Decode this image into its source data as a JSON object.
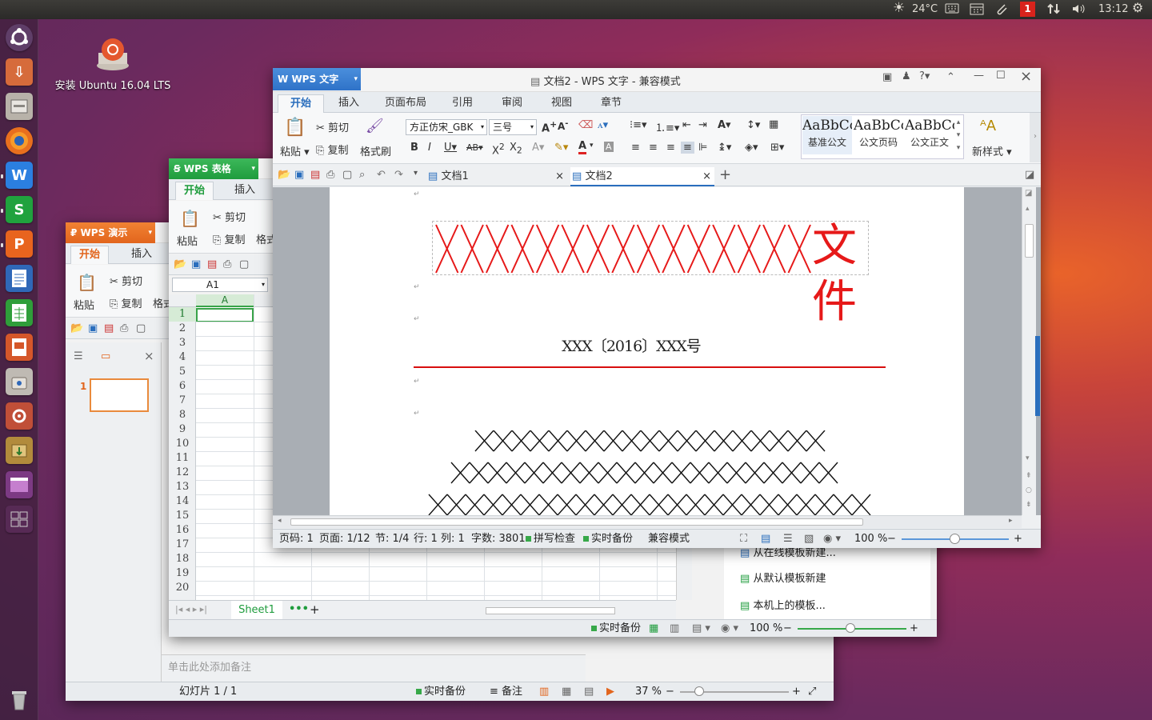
{
  "topbar": {
    "temperature": "24°C",
    "notification_count": "1",
    "time": "13:12"
  },
  "desktop": {
    "install_label": "安装 Ubuntu 16.04 LTS"
  },
  "writer": {
    "app_badge": "WPS 文字",
    "window_title": "文档2 - WPS 文字 - 兼容模式",
    "tabs": [
      "开始",
      "插入",
      "页面布局",
      "引用",
      "审阅",
      "视图",
      "章节"
    ],
    "ribbon": {
      "paste": "粘贴",
      "cut": "剪切",
      "copy": "复制",
      "format_painter": "格式刷",
      "font": "方正仿宋_GBK",
      "size": "三号",
      "new_style": "新样式"
    },
    "styles": [
      {
        "preview": "AaBbCc",
        "name": "基准公文"
      },
      {
        "preview": "AaBbCcI",
        "name": "公文页码"
      },
      {
        "preview": "AaBbCc",
        "name": "公文正文"
      }
    ],
    "doc_tabs": [
      "文档1",
      "文档2"
    ],
    "doc": {
      "header_x": "XXXXXXXXXXXXXXX",
      "header_word": "文件",
      "doc_number": "XXX〔2016〕XXX号"
    },
    "status": {
      "page": "页码: 1",
      "pages": "页面: 1/12",
      "section": "节: 1/4",
      "row": "行: 1",
      "col": "列: 1",
      "words": "字数: 3801",
      "spell": "拼写检查",
      "backup": "实时备份",
      "mode": "兼容模式",
      "zoom": "100 %"
    }
  },
  "sheet": {
    "app_badge": "WPS 表格",
    "tabs": [
      "开始",
      "插入"
    ],
    "ribbon": {
      "paste": "粘贴",
      "cut": "剪切",
      "copy": "复制",
      "format": "格式"
    },
    "cell_ref": "A1",
    "col_a": "A",
    "rows": [
      "1",
      "2",
      "3",
      "4",
      "5",
      "6",
      "7",
      "8",
      "9",
      "10",
      "11",
      "12",
      "13",
      "14",
      "15",
      "16",
      "17",
      "18",
      "19",
      "20"
    ],
    "sheet_tab": "Sheet1",
    "templates": [
      "从在线模板新建...",
      "从默认模板新建",
      "本机上的模板..."
    ],
    "status": {
      "backup": "实时备份",
      "zoom": "100 %"
    }
  },
  "pres": {
    "app_badge": "WPS 演示",
    "tabs": [
      "开始",
      "插入"
    ],
    "ribbon": {
      "paste": "粘贴",
      "cut": "剪切",
      "copy": "复制",
      "format": "格式"
    },
    "slide_num": "1",
    "notes_placeholder": "单击此处添加备注",
    "status": {
      "slide": "幻灯片 1 / 1",
      "backup": "实时备份",
      "notes": "备注",
      "zoom": "37 %"
    }
  }
}
